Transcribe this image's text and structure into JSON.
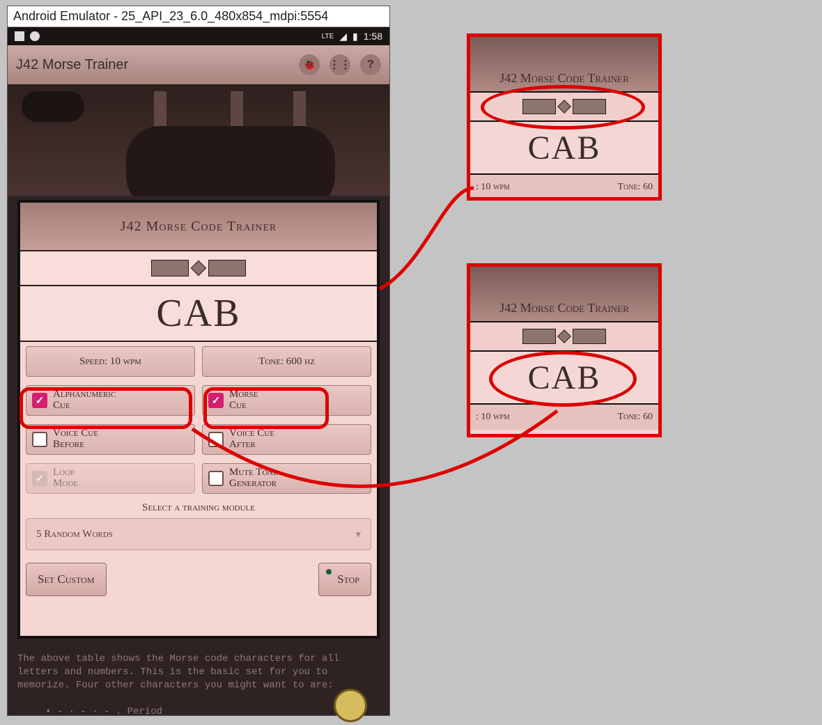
{
  "emulator": {
    "window_title": "Android Emulator - 25_API_23_6.0_480x854_mdpi:5554"
  },
  "statusbar": {
    "network": "LTE",
    "clock": "1:58"
  },
  "appbar": {
    "title": "J42 Morse Trainer",
    "icons": {
      "bug": "bug-icon",
      "share": "share-icon",
      "help": "help-icon"
    }
  },
  "card": {
    "title": "J42 Morse Code Trainer",
    "display_text": "CAB",
    "speed_label": "Speed: 10 wpm",
    "tone_label": "Tone: 600 hz",
    "options": {
      "alpha_cue": {
        "label": "Alphanumeric\nCue",
        "checked": true,
        "enabled": true
      },
      "morse_cue": {
        "label": "Morse\nCue",
        "checked": true,
        "enabled": true
      },
      "voice_before": {
        "label": "Voice Cue\nBefore",
        "checked": false,
        "enabled": true
      },
      "voice_after": {
        "label": "Voice Cue\nAfter",
        "checked": false,
        "enabled": true
      },
      "loop_mode": {
        "label": "Loop\nMode",
        "checked": true,
        "enabled": false
      },
      "mute_tone": {
        "label": "Mute Tone\nGenerator",
        "checked": false,
        "enabled": true
      }
    },
    "module_label": "Select a training module",
    "module_value": "5 Random Words",
    "set_custom": "Set Custom",
    "stop": "Stop"
  },
  "below_text": {
    "para": "The above table shows the Morse code characters for all letters and numbers.  This is the basic set for you to memorize.  Four other characters you might want to      are:",
    "bullet1": "• - · - · -   . Period"
  },
  "callouts": {
    "title": "J42 Morse Code Trainer",
    "display_text": "CAB",
    "foot_left": ": 10 wpm",
    "foot_right": "Tone: 60"
  }
}
